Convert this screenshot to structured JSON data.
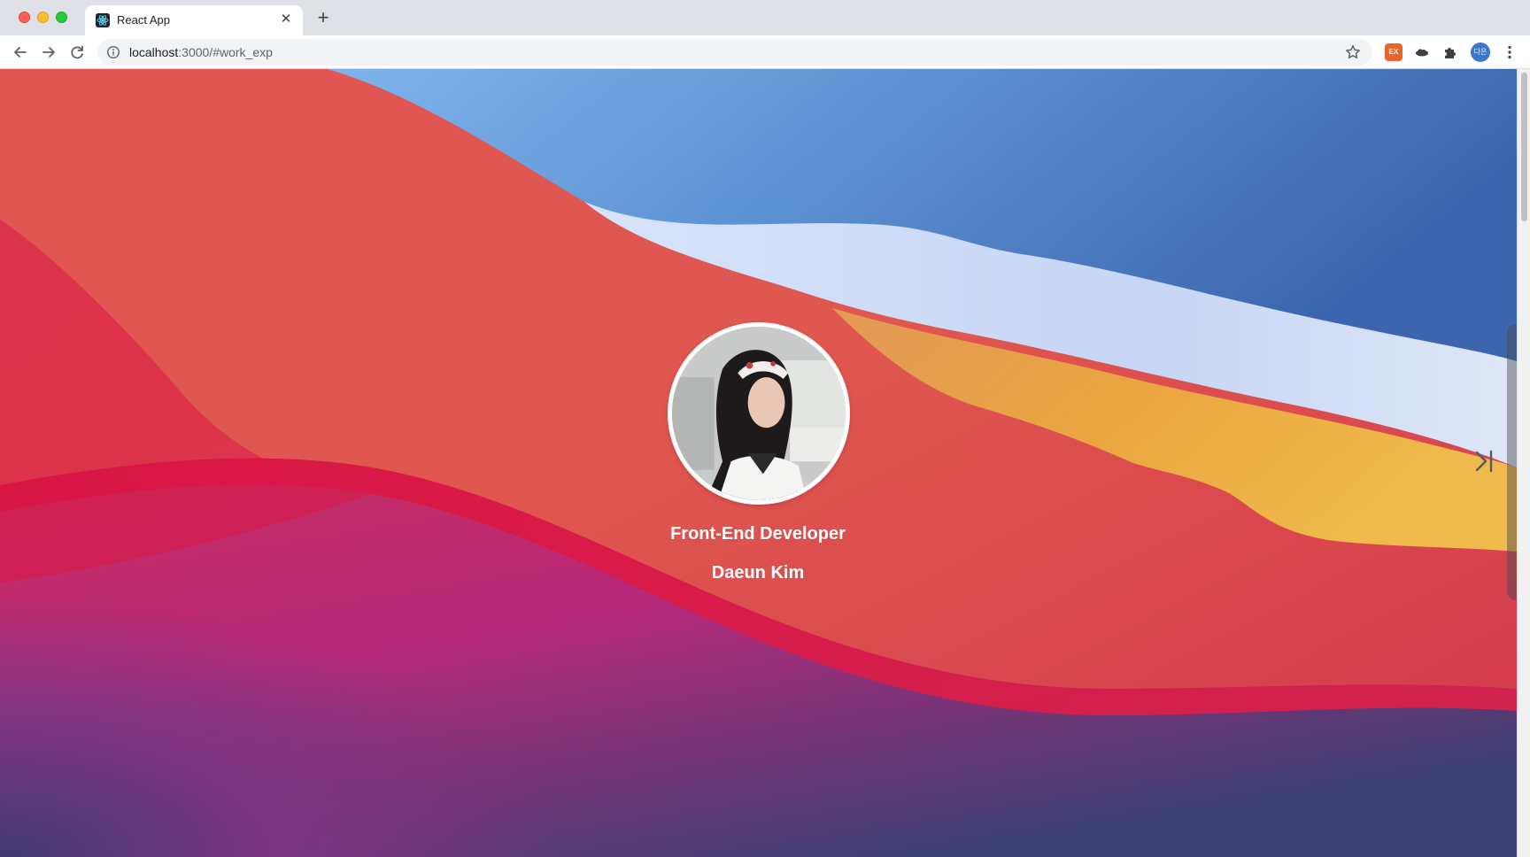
{
  "browser": {
    "tab_title": "React App",
    "tab_close": "✕",
    "new_tab": "+",
    "url_host": "localhost",
    "url_rest": ":3000/#work_exp",
    "ext_label": "EX",
    "profile_initials": "다은"
  },
  "profile": {
    "role": "Front-End Developer",
    "name": "Daeun Kim"
  },
  "icons": {
    "back": "back-arrow-icon",
    "forward": "forward-arrow-icon",
    "reload": "reload-icon",
    "info": "info-icon",
    "star": "star-icon",
    "extensions": "puzzle-icon",
    "menu": "kebab-menu-icon",
    "next": "skip-next-icon"
  },
  "colors": {
    "red": "#d9334f",
    "blue": "#4a78c2",
    "orange": "#e9a23d",
    "magenta": "#b12a75"
  }
}
